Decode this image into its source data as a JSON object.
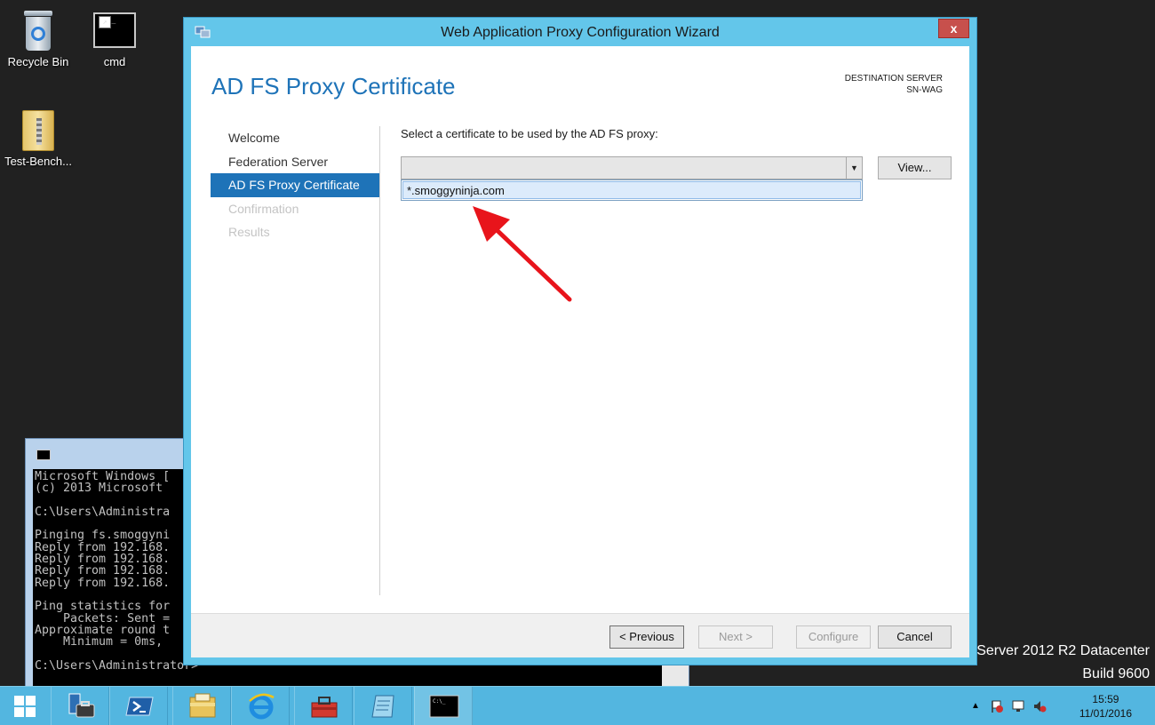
{
  "desktop": {
    "icons": [
      {
        "label": "Recycle Bin",
        "icon": "recycle-bin-icon"
      },
      {
        "label": "cmd",
        "icon": "cmd-shortcut-icon"
      },
      {
        "label": "Test-Bench...",
        "icon": "zip-folder-icon"
      }
    ],
    "server_edition": "Server 2012 R2 Datacenter",
    "build": "Build 9600"
  },
  "console": {
    "lines": [
      "Microsoft Windows [",
      "(c) 2013 Microsoft ",
      "",
      "C:\\Users\\Administra",
      "",
      "Pinging fs.smoggyni",
      "Reply from 192.168.",
      "Reply from 192.168.",
      "Reply from 192.168.",
      "Reply from 192.168.",
      "",
      "Ping statistics for",
      "    Packets: Sent =",
      "Approximate round t",
      "    Minimum = 0ms, ",
      "",
      "C:\\Users\\Administrator>"
    ]
  },
  "wizard": {
    "title": "Web Application Proxy Configuration Wizard",
    "close_label": "x",
    "page_title": "AD FS Proxy Certificate",
    "destination_label": "DESTINATION SERVER",
    "destination_server": "SN-WAG",
    "nav": [
      {
        "label": "Welcome",
        "state": "normal"
      },
      {
        "label": "Federation Server",
        "state": "normal"
      },
      {
        "label": "AD FS Proxy Certificate",
        "state": "active"
      },
      {
        "label": "Confirmation",
        "state": "disabled"
      },
      {
        "label": "Results",
        "state": "disabled"
      }
    ],
    "prompt": "Select a certificate to be used by the AD FS proxy:",
    "combo_value": "",
    "dropdown_options": [
      "*.smoggyninja.com"
    ],
    "view_label": "View...",
    "buttons": {
      "previous": "< Previous",
      "next": "Next >",
      "configure": "Configure",
      "cancel": "Cancel"
    }
  },
  "annotation": {
    "color": "#e8141b"
  },
  "taskbar": {
    "apps": [
      "server-manager-icon",
      "powershell-icon",
      "file-explorer-icon",
      "internet-explorer-icon",
      "toolbox-icon",
      "notepad-icon",
      "cmd-icon"
    ],
    "time": "15:59",
    "date": "11/01/2016"
  }
}
